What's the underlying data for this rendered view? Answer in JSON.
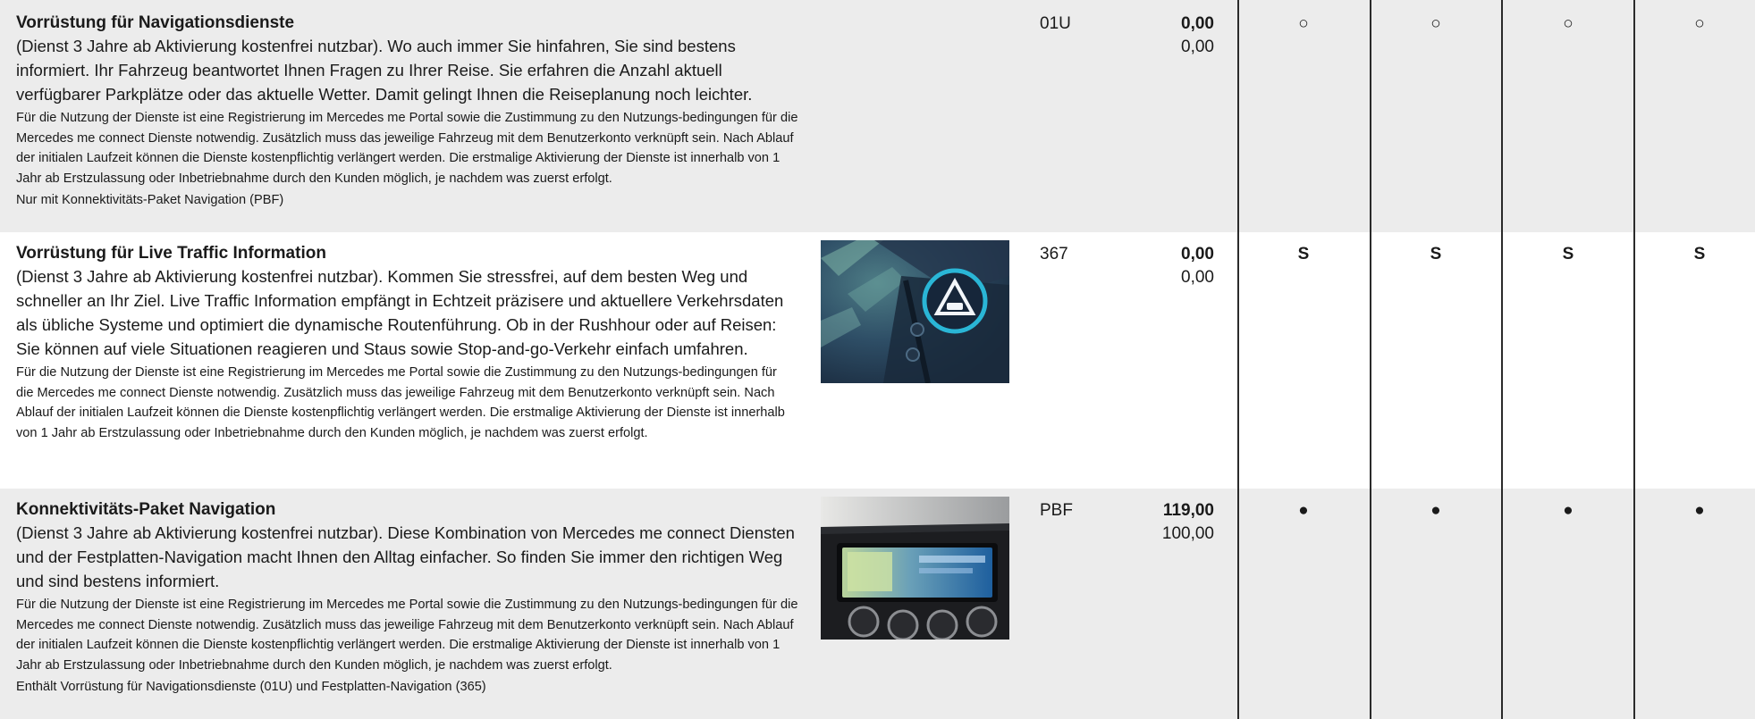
{
  "options": [
    {
      "title": "Vorrüstung für Navigationsdienste",
      "description": "(Dienst 3 Jahre ab Aktivierung kostenfrei nutzbar). Wo auch immer Sie hinfahren, Sie sind bestens informiert. Ihr Fahrzeug beantwortet Ihnen Fragen zu Ihrer Reise. Sie erfahren die Anzahl aktuell verfügbarer Parkplätze oder das aktuelle Wetter. Damit gelingt Ihnen die Reiseplanung noch leichter.",
      "fine_print": "Für die Nutzung der Dienste ist eine Registrierung im Mercedes me Portal sowie die Zustimmung zu den Nutzungs-bedingungen für die Mercedes me connect Dienste notwendig. Zusätzlich muss das jeweilige Fahrzeug mit dem Benutzerkonto verknüpft sein. Nach Ablauf der initialen Laufzeit können die Dienste kostenpflichtig verlängert werden. Die erstmalige Aktivierung der Dienste ist innerhalb von 1 Jahr ab Erstzulassung oder Inbetriebnahme durch den Kunden möglich, je nachdem was zuerst erfolgt.",
      "note": "Nur mit Konnektivitäts-Paket Navigation (PBF)",
      "code": "01U",
      "price_gross": "0,00",
      "price_net": "0,00",
      "availability": [
        "○",
        "○",
        "○",
        "○"
      ]
    },
    {
      "title": "Vorrüstung für Live Traffic Information",
      "description": "(Dienst 3 Jahre ab Aktivierung kostenfrei nutzbar). Kommen Sie stressfrei, auf dem besten Weg und schneller an Ihr Ziel. Live Traffic Information empfängt in Echtzeit präzisere und aktuellere Verkehrsdaten als übliche Systeme und optimiert die dynamische Routenführung. Ob in der Rushhour oder auf Reisen: Sie können auf viele Situationen reagieren und Staus sowie Stop-and-go-Verkehr einfach umfahren.",
      "fine_print": "Für die Nutzung der Dienste ist eine Registrierung im Mercedes me Portal sowie die Zustimmung zu den Nutzungs-bedingungen für die Mercedes me connect Dienste notwendig. Zusätzlich muss das jeweilige Fahrzeug mit dem Benutzerkonto verknüpft sein. Nach Ablauf der initialen Laufzeit können die Dienste kostenpflichtig verlängert werden. Die erstmalige Aktivierung der Dienste ist innerhalb von 1 Jahr ab Erstzulassung oder Inbetriebnahme durch den Kunden möglich, je nachdem was zuerst erfolgt.",
      "code": "367",
      "price_gross": "0,00",
      "price_net": "0,00",
      "availability": [
        "S",
        "S",
        "S",
        "S"
      ]
    },
    {
      "title": "Konnektivitäts-Paket Navigation",
      "description": "(Dienst 3 Jahre ab Aktivierung kostenfrei nutzbar). Diese Kombination von Mercedes me connect Diensten und der Festplatten-Navigation macht Ihnen den Alltag einfacher. So finden Sie immer den richtigen Weg und sind bestens informiert.",
      "fine_print": "Für die Nutzung der Dienste ist eine Registrierung im Mercedes me Portal sowie die Zustimmung zu den Nutzungs-bedingungen für die Mercedes me connect Dienste notwendig. Zusätzlich muss das jeweilige Fahrzeug mit dem Benutzerkonto verknüpft sein. Nach Ablauf der initialen Laufzeit können die Dienste kostenpflichtig verlängert werden. Die erstmalige Aktivierung der Dienste ist innerhalb von 1 Jahr ab Erstzulassung oder Inbetriebnahme durch den Kunden möglich, je nachdem was zuerst erfolgt.",
      "note": "Enthält Vorrüstung für Navigationsdienste (01U) und Festplatten-Navigation (365)",
      "code": "PBF",
      "price_gross": "119,00",
      "price_net": "100,00",
      "availability": [
        "●",
        "●",
        "●",
        "●"
      ]
    }
  ],
  "colors": {
    "row_shade": "#ececec",
    "text": "#1a1a1a",
    "rule": "#2b2b2b"
  }
}
